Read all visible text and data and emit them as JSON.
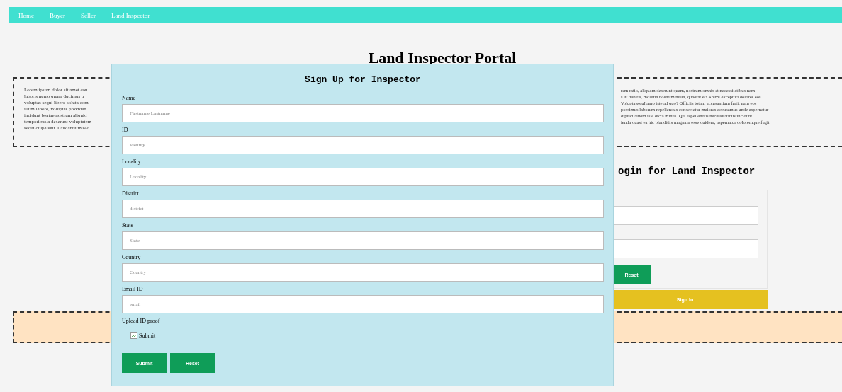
{
  "nav": {
    "links": [
      "Home",
      "Buyer",
      "Seller",
      "Land Inspector"
    ]
  },
  "page_title": "Land Inspector Portal",
  "intro": {
    "left_lines": [
      "Lorem ipsum dolor sit amet con",
      "laboris nemo quam ducimus q",
      "voluptas sequi libero soluta com",
      "illum labore, voluptas providen",
      "incidunt beatae nostrum aliquid",
      "temporibus a deserunt voluptatem",
      "sequi culpa sint. Laudantium sed"
    ],
    "right_lines": [
      "rem ratio, aliquam deserunt quam, nostrum omnis et necessitatibus nam",
      "s ut debitis, mollitia nostrum nulla, quaerat et! Animi excepturi dolores eos",
      "Voluptates ullamo iste ad quo? Officiis totam accusantium fugit nam eos",
      "possimus laborum repellendus consectetur maiores accusamus unde aspernatur",
      "dipisci autem iste dicta minus. Qui repellendus necessitatibus incidunt",
      "ienda quasi ea hic blanditiis magnam esse quidem, aspernatur doloremque fugit"
    ]
  },
  "login": {
    "title": "ogin for Land Inspector",
    "reset_button": "Reset",
    "sign_in_button": "Sign In"
  },
  "signup": {
    "title": "Sign Up for Inspector",
    "fields": [
      {
        "label": "Name",
        "placeholder": "Firstname Lastname"
      },
      {
        "label": "ID",
        "placeholder": "Identity"
      },
      {
        "label": "Locality",
        "placeholder": "Locality"
      },
      {
        "label": "District",
        "placeholder": "district"
      },
      {
        "label": "State",
        "placeholder": "State"
      },
      {
        "label": "Country",
        "placeholder": "Country"
      },
      {
        "label": "Email ID",
        "placeholder": "email"
      }
    ],
    "upload_label": "Upload ID proof",
    "upload_image_alt": "Submit",
    "buttons": [
      "Submit",
      "Reset"
    ]
  }
}
